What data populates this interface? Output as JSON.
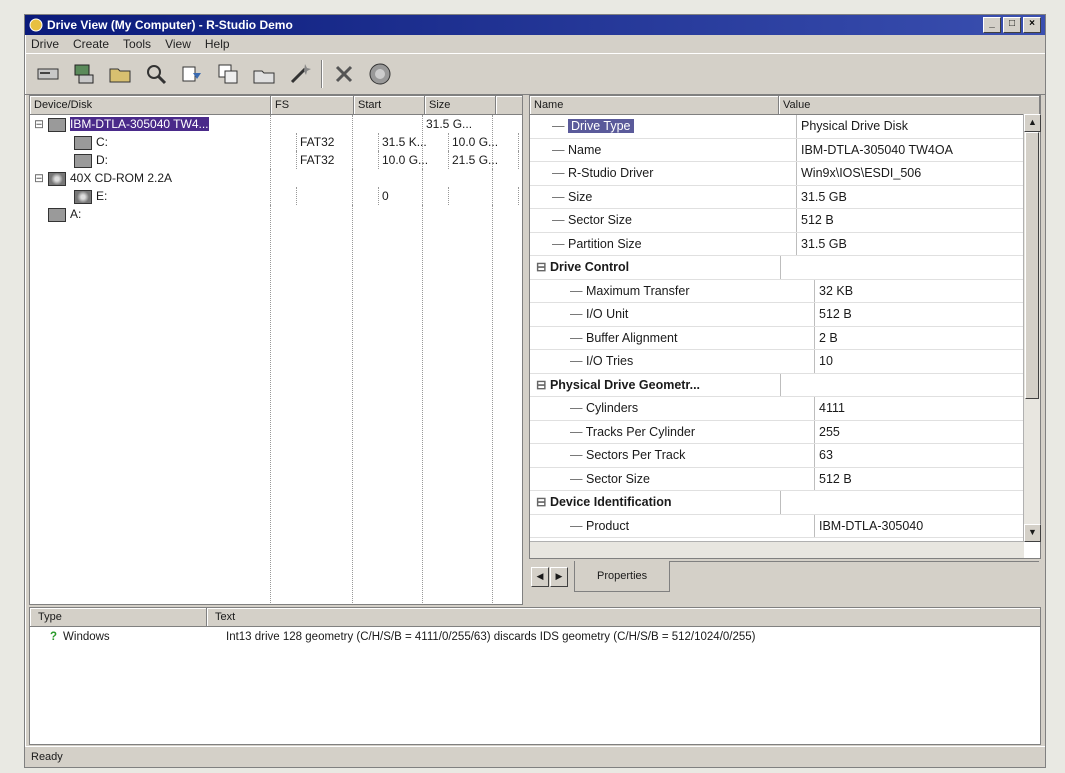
{
  "window": {
    "title": "Drive View (My Computer) - R-Studio Demo",
    "btn_min": "_",
    "btn_max": "□",
    "btn_close": "×"
  },
  "menu": [
    "Drive",
    "Create",
    "Tools",
    "View",
    "Help"
  ],
  "toolbar_icons": [
    "drives-icon",
    "connect-icon",
    "open-icon",
    "scan-icon",
    "recover-icon",
    "recover-marked-icon",
    "image-icon",
    "wizard-icon",
    "stop-icon",
    "info-icon"
  ],
  "left_pane": {
    "headers": [
      "Device/Disk",
      "FS",
      "Start",
      "Size"
    ],
    "rows": [
      {
        "indent": 0,
        "expander": "⊟",
        "icon": "hard-disk-icon",
        "label": "IBM-DTLA-305040 TW4...",
        "fs": "",
        "start": "",
        "size": "31.5 G...",
        "selected": true
      },
      {
        "indent": 1,
        "expander": "",
        "icon": "partition-icon",
        "label": "C:",
        "fs": "FAT32",
        "start": "31.5 K...",
        "size": "10.0 G...",
        "selected": false
      },
      {
        "indent": 1,
        "expander": "",
        "icon": "partition-icon",
        "label": "D:",
        "fs": "FAT32",
        "start": "10.0 G...",
        "size": "21.5 G...",
        "selected": false
      },
      {
        "indent": 0,
        "expander": "⊟",
        "icon": "cdrom-icon",
        "label": "40X CD-ROM 2.2A",
        "fs": "",
        "start": "",
        "size": "",
        "selected": false
      },
      {
        "indent": 1,
        "expander": "",
        "icon": "cd-icon",
        "label": "E:",
        "fs": "",
        "start": "0",
        "size": "",
        "selected": false
      },
      {
        "indent": 0,
        "expander": "",
        "icon": "floppy-icon",
        "label": "A:",
        "fs": "",
        "start": "",
        "size": "",
        "selected": false
      }
    ]
  },
  "properties": {
    "headers": [
      "Name",
      "Value"
    ],
    "rows": [
      {
        "level": 1,
        "name": "Drive Type",
        "value": "Physical Drive Disk",
        "group": false,
        "highlight": true
      },
      {
        "level": 1,
        "name": "Name",
        "value": "IBM-DTLA-305040 TW4OA",
        "group": false,
        "highlight": false
      },
      {
        "level": 1,
        "name": "R-Studio Driver",
        "value": "Win9x\\IOS\\ESDI_506",
        "group": false,
        "highlight": false
      },
      {
        "level": 1,
        "name": "Size",
        "value": "31.5 GB",
        "group": false,
        "highlight": false
      },
      {
        "level": 1,
        "name": "Sector Size",
        "value": "512 B",
        "group": false,
        "highlight": false
      },
      {
        "level": 1,
        "name": "Partition Size",
        "value": "31.5 GB",
        "group": false,
        "highlight": false
      },
      {
        "level": 0,
        "name": "Drive Control",
        "value": "",
        "group": true,
        "highlight": false
      },
      {
        "level": 2,
        "name": "Maximum Transfer",
        "value": "32 KB",
        "group": false,
        "highlight": false
      },
      {
        "level": 2,
        "name": "I/O Unit",
        "value": "512 B",
        "group": false,
        "highlight": false
      },
      {
        "level": 2,
        "name": "Buffer Alignment",
        "value": "2 B",
        "group": false,
        "highlight": false
      },
      {
        "level": 2,
        "name": "I/O Tries",
        "value": "10",
        "group": false,
        "highlight": false
      },
      {
        "level": 0,
        "name": "Physical Drive Geometr...",
        "value": "",
        "group": true,
        "highlight": false
      },
      {
        "level": 2,
        "name": "Cylinders",
        "value": "4111",
        "group": false,
        "highlight": false
      },
      {
        "level": 2,
        "name": "Tracks Per Cylinder",
        "value": "255",
        "group": false,
        "highlight": false
      },
      {
        "level": 2,
        "name": "Sectors Per Track",
        "value": "63",
        "group": false,
        "highlight": false
      },
      {
        "level": 2,
        "name": "Sector Size",
        "value": "512 B",
        "group": false,
        "highlight": false
      },
      {
        "level": 0,
        "name": "Device Identification",
        "value": "",
        "group": true,
        "highlight": false
      },
      {
        "level": 2,
        "name": "Product",
        "value": "IBM-DTLA-305040",
        "group": false,
        "highlight": false
      }
    ]
  },
  "tabs": {
    "active": "Properties"
  },
  "log": {
    "headers": [
      "Type",
      "Text"
    ],
    "rows": [
      {
        "type": "Windows",
        "text": "Int13 drive 128 geometry (C/H/S/B = 4111/0/255/63) discards IDS geometry (C/H/S/B = 512/1024/0/255)"
      }
    ]
  },
  "status": "Ready",
  "colors": {
    "title_from": "#0a1a7a",
    "title_to": "#3a4fb0",
    "selection": "#4a2a8a"
  }
}
